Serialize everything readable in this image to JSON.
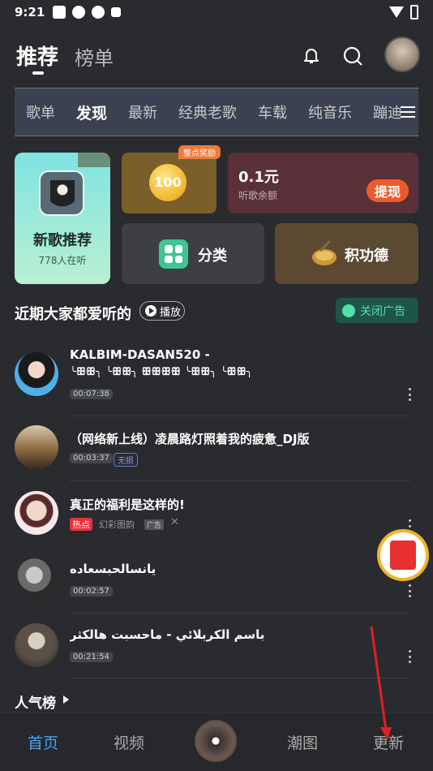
{
  "status": {
    "time": "9:21"
  },
  "header": {
    "tab_recommend": "推荐",
    "tab_rank": "榜单"
  },
  "categories": [
    "歌单",
    "发现",
    "最新",
    "经典老歌",
    "车载",
    "纯音乐",
    "蹦迪"
  ],
  "cards": {
    "new_songs_title": "新歌推荐",
    "new_songs_sub": "778人在听",
    "coin_badge": "整点奖励",
    "coin_value": "100",
    "balance_amount": "0.1元",
    "balance_label": "听歌余额",
    "withdraw_label": "提现",
    "category_label": "分类",
    "merit_label": "积功德"
  },
  "section": {
    "title": "近期大家都爱听的",
    "play_label": "播放",
    "close_ad_label": "关闭广告"
  },
  "songs": [
    {
      "name_line1": "KALBIM-DASAN520 -",
      "name_line2": "╰ꕥꕥ╮ ╰ꕥꕥ╮ ꕥꕥꕥꕥ ╰ꕥꕥ╮ ╰ꕥꕥ╮",
      "duration": "00:07:38"
    },
    {
      "name": "（网络新上线）凌晨路灯照着我的疲惫_DJ版",
      "duration": "00:03:37",
      "tag": "无损"
    },
    {
      "name": "真正的福利是这样的!",
      "hot": "热点",
      "source": "幻彩图韵",
      "ad": "广告"
    },
    {
      "name": "يانسالحبسعاده",
      "duration": "00:02:57"
    },
    {
      "name": "باسم الكربلائي - ماحسبت هالكثر",
      "duration": "00:21:54"
    }
  ],
  "popular_label": "人气榜",
  "nav": {
    "home": "首页",
    "video": "视频",
    "trend": "潮图",
    "update": "更新"
  },
  "colors": {
    "accent": "#4aa3f0",
    "annotation_arrow": "#e02020"
  }
}
